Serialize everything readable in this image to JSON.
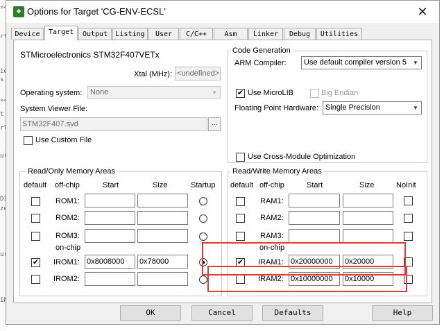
{
  "window": {
    "title": "Options for Target 'CG-ENV-ECSL'",
    "close_glyph": "✕"
  },
  "background_code": [
    "»«",
    "rt",
    "ie",
    "s",
    "»«",
    "t",
    "rl",
    "u(",
    "DI",
    "ze",
    "u(",
    "IN"
  ],
  "tabs": [
    "Device",
    "Target",
    "Output",
    "Listing",
    "User",
    "C/C++",
    "Asm",
    "Linker",
    "Debug",
    "Utilities"
  ],
  "active_tab": "Target",
  "device": {
    "name": "STMicroelectronics STM32F407VETx"
  },
  "xtal": {
    "label": "Xtal (MHz):",
    "value": "<undefined>"
  },
  "os": {
    "label": "Operating system:",
    "value": "None"
  },
  "sysviewer": {
    "label": "System Viewer File:",
    "value": "STM32F407.svd",
    "browse": "..."
  },
  "custom_file": {
    "label": "Use Custom File",
    "checked": false
  },
  "codegen": {
    "legend": "Code Generation",
    "compiler_label": "ARM Compiler:",
    "compiler_value": "Use default compiler version 5",
    "microlib_label": "Use MicroLIB",
    "microlib_checked": true,
    "bigendian_label": "Big Endian",
    "bigendian_checked": false,
    "fpu_label": "Floating Point Hardware:",
    "fpu_value": "Single Precision",
    "cross_label": "Use Cross-Module Optimization",
    "cross_checked": false
  },
  "rom": {
    "legend": "Read/Only Memory Areas",
    "headers": {
      "default": "default",
      "offchip": "off-chip",
      "start": "Start",
      "size": "Size",
      "startup": "Startup"
    },
    "onchip_label": "on-chip",
    "rows": [
      {
        "name": "ROM1:",
        "start": "",
        "size": "",
        "checked": false,
        "startup": false
      },
      {
        "name": "ROM2:",
        "start": "",
        "size": "",
        "checked": false,
        "startup": false
      },
      {
        "name": "ROM3:",
        "start": "",
        "size": "",
        "checked": false,
        "startup": false
      },
      {
        "name": "IROM1:",
        "start": "0x8008000",
        "size": "0x78000",
        "checked": true,
        "startup": true
      },
      {
        "name": "IROM2:",
        "start": "",
        "size": "",
        "checked": false,
        "startup": false
      }
    ]
  },
  "ram": {
    "legend": "Read/Write Memory Areas",
    "headers": {
      "default": "default",
      "offchip": "off-chip",
      "start": "Start",
      "size": "Size",
      "noinit": "NoInit"
    },
    "onchip_label": "on-chip",
    "rows": [
      {
        "name": "RAM1:",
        "start": "",
        "size": "",
        "checked": false,
        "noinit": false
      },
      {
        "name": "RAM2:",
        "start": "",
        "size": "",
        "checked": false,
        "noinit": false
      },
      {
        "name": "RAM3:",
        "start": "",
        "size": "",
        "checked": false,
        "noinit": false
      },
      {
        "name": "IRAM1:",
        "start": "0x20000000",
        "size": "0x20000",
        "checked": true,
        "noinit": false
      },
      {
        "name": "IRAM2:",
        "start": "0x10000000",
        "size": "0x10000",
        "checked": false,
        "noinit": false
      }
    ]
  },
  "buttons": {
    "ok": "OK",
    "cancel": "Cancel",
    "defaults": "Defaults",
    "help": "Help"
  },
  "colors": {
    "highlight_box": "#e53935",
    "dialog_bg": "#f0f0f0"
  }
}
